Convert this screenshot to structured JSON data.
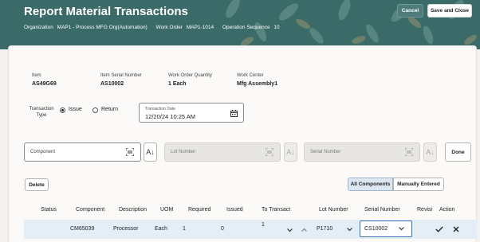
{
  "header": {
    "title": "Report Material Transactions",
    "organization_label": "Organization",
    "organization_value": "MAP1 - Process MFG Org(Automation)",
    "work_order_label": "Work Order",
    "work_order_value": "MAP1-1014",
    "op_seq_label": "Operation Sequence",
    "op_seq_value": "10",
    "cancel_label": "Cancel",
    "save_close_label": "Save and Close"
  },
  "summary": {
    "item_label": "Item",
    "item_value": "AS49G69",
    "serial_label": "Item Serial Number",
    "serial_value": "AS10002",
    "woq_label": "Work Order Quantity",
    "woq_value": "1 Each",
    "wc_label": "Work Center",
    "wc_value": "Mfg Assembly1"
  },
  "transaction": {
    "type_label": "Transaction Type",
    "issue_label": "Issue",
    "return_label": "Return",
    "selected": "Issue",
    "date_label": "Transaction Date",
    "date_value": "12/20/24 10:25 AM"
  },
  "scan_row": {
    "component_placeholder": "Component",
    "lot_placeholder": "Lot Number",
    "serial_placeholder": "Serial Number",
    "done_label": "Done"
  },
  "toolbar": {
    "delete_label": "Delete",
    "all_components_label": "All Components",
    "manually_entered_label": "Manually Entered"
  },
  "table": {
    "columns": [
      "Status",
      "Component",
      "Description",
      "UOM",
      "Required",
      "Issued",
      "To Transact",
      "Lot Number",
      "Serial Number",
      "Revisi",
      "Action"
    ],
    "rows": [
      {
        "status": "",
        "component": "CM65039",
        "description": "Processor",
        "uom": "Each",
        "required": "1",
        "issued": "0",
        "to_transact": "1",
        "lot_number": "P1710",
        "serial_number": "CS10002",
        "revision": ""
      }
    ]
  },
  "colors": {
    "header_bg": "#3b6b69",
    "selected_row": "#e4eef7",
    "active_segment": "#dde7f2"
  }
}
